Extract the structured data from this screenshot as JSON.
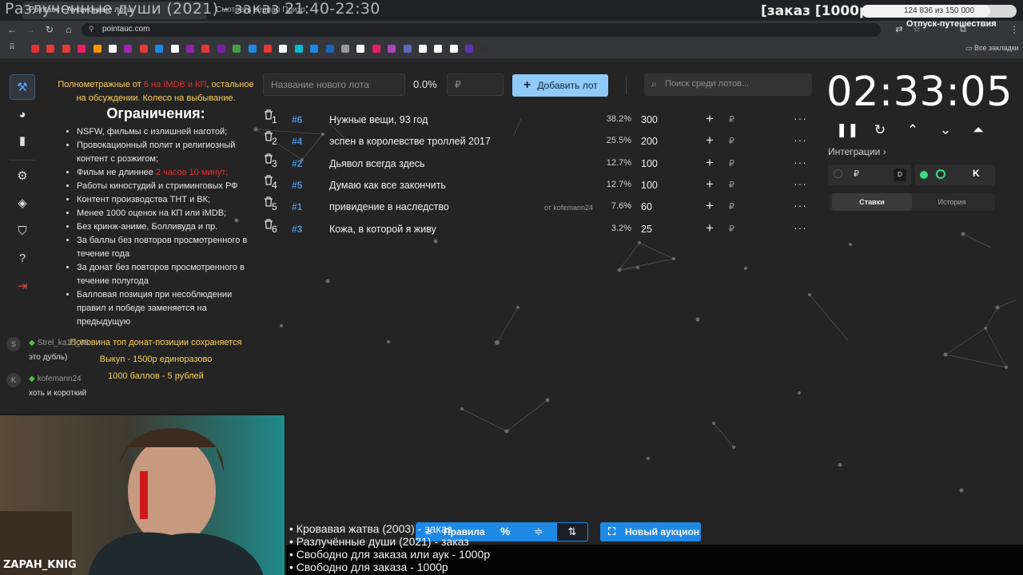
{
  "browser": {
    "tab_title": "Pointauc - Аукционные лоты",
    "tab2_title": "Смотреть сериал Призраки",
    "url": "pointauc.com",
    "all_bookmarks": "Все закладки"
  },
  "stream_overlay": {
    "title": "Разлученные души (2021) - заказ 21:40-22:30",
    "order_label": "[заказ [1000р]",
    "goal_text": "124 836 из 150 000",
    "goal_fraction": 0.832,
    "vacation": "Отпуск-путешествия",
    "cam_name": "ZAPAH_KNIG",
    "bullets": [
      "• Кровавая жатва (2003) - заказ",
      "• Разлучённые души (2021) - заказ",
      "• Свободно для заказа или аук - 1000р",
      "• Свободно для заказа - 1000р"
    ]
  },
  "rules": {
    "intro_before": "Полнометражные от ",
    "intro_red": "6 на IMDB и КП",
    "intro_after": ", остальное на обсуждении. Колесо на выбывание.",
    "heading": "Ограничения:",
    "items": [
      "NSFW, фильмы с излишней наготой;",
      "Провокационный полит и религиозный контент с розжигом;",
      "Фильм не длиннее ",
      "Работы киностудий и стриминговых РФ",
      "Контент производства ТНТ и ВК;",
      "Менее 1000 оценок на КП или iMDB;",
      "Без кринж-аниме, Болливуда и пр.",
      "За баллы без повторов просмотренного в течение года",
      "За донат без повторов просмотренного в течение полугода",
      "Балловая позиция при несоблюдении правил и победе заменяется на предыдущую"
    ],
    "length_red": "2 часов 10 минут;",
    "gold_lines": [
      "Половина топ донат-позиции сохраняется",
      "Выкуп - 1500р единоразово",
      "1000 баллов - 5 рублей"
    ]
  },
  "chat": [
    {
      "avatar": "S",
      "name": "Strel_ka15_88",
      "text": "это дубль)"
    },
    {
      "avatar": "K",
      "name": "kofemann24",
      "text": "хоть и короткий"
    }
  ],
  "controls": {
    "new_lot_placeholder": "Название нового лота",
    "total_percent": "0.0%",
    "amount_placeholder": "₽",
    "add_lot": "Добавить лот",
    "search_placeholder": "Поиск среди лотов..."
  },
  "lots": [
    {
      "num": "1",
      "id": "#6",
      "name": "Нужные вещи, 93 год",
      "from": "",
      "percent": "38.2%",
      "amount": "300"
    },
    {
      "num": "2",
      "id": "#4",
      "name": "эспен в королевстве троллей 2017",
      "from": "",
      "percent": "25.5%",
      "amount": "200"
    },
    {
      "num": "3",
      "id": "#2",
      "name": "Дьявол всегда здесь",
      "from": "",
      "percent": "12.7%",
      "amount": "100"
    },
    {
      "num": "4",
      "id": "#5",
      "name": "Думаю как все закончить",
      "from": "",
      "percent": "12.7%",
      "amount": "100"
    },
    {
      "num": "5",
      "id": "#1",
      "name": "привидение в наследство",
      "from": "от kofemann24",
      "percent": "7.6%",
      "amount": "60"
    },
    {
      "num": "6",
      "id": "#3",
      "name": "Кожа, в которой я живу",
      "from": "",
      "percent": "3.2%",
      "amount": "25"
    }
  ],
  "currency_symbol": "₽",
  "timer": {
    "value": "02:33:05",
    "integrations_label": "Интеграции ›"
  },
  "history_tabs": [
    "Ставки",
    "История"
  ],
  "bottom": {
    "rules_label": "Правила",
    "new_auction": "Новый аукцион"
  },
  "colors": {
    "accent": "#1e88e5",
    "add_button": "#90caf9",
    "lot_id": "#4a90d9",
    "rules_gold": "#ffd05a",
    "rules_red": "#e03030"
  }
}
